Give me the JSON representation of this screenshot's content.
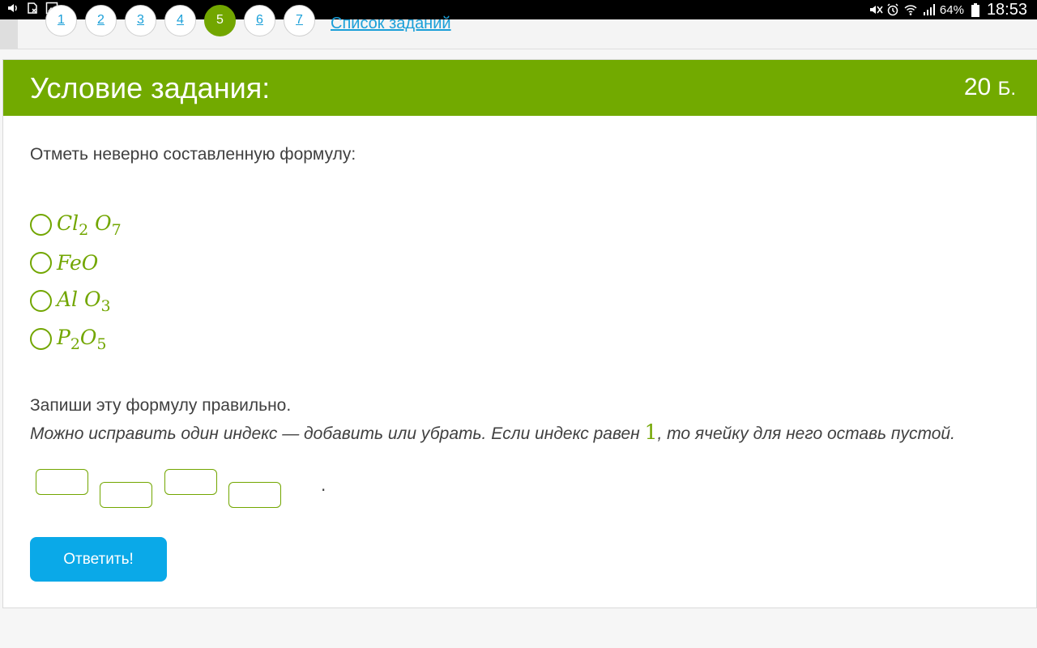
{
  "status_bar": {
    "battery_percent": "64%",
    "time": "18:53",
    "icons_left": [
      "volume-icon",
      "sim-icon",
      "image-icon"
    ],
    "icons_right": [
      "mute-icon",
      "alarm-icon",
      "wifi-icon",
      "signal-icon",
      "battery-icon"
    ]
  },
  "nav": {
    "numbers": [
      "1",
      "2",
      "3",
      "4",
      "5",
      "6",
      "7"
    ],
    "active": "5",
    "task_list_link": "Список заданий"
  },
  "task": {
    "title": "Условие задания:",
    "points": "20",
    "points_unit": "Б.",
    "question": "Отметь неверно составленную формулу:",
    "options": [
      {
        "main": "Cl",
        "sub1": "2",
        "second": " O",
        "sub2": "7"
      },
      {
        "main": "FeO",
        "sub1": "",
        "second": "",
        "sub2": ""
      },
      {
        "main": "Al",
        "sub1": "",
        "second": " O",
        "sub2": "3"
      },
      {
        "main": "P",
        "sub1": "2",
        "second": "O",
        "sub2": "5"
      }
    ],
    "instruction": "Запиши эту формулу правильно.",
    "hint_before": "Можно исправить один индекс — добавить или убрать. Если индекс равен ",
    "hint_number": "1",
    "hint_after": ", то ячейку для него оставь пустой.",
    "answer_period": ".",
    "submit_label": "Ответить!"
  },
  "colors": {
    "accent_green": "#72aa00",
    "button_blue": "#0aa9e8",
    "link_blue": "#1a9fd8"
  }
}
